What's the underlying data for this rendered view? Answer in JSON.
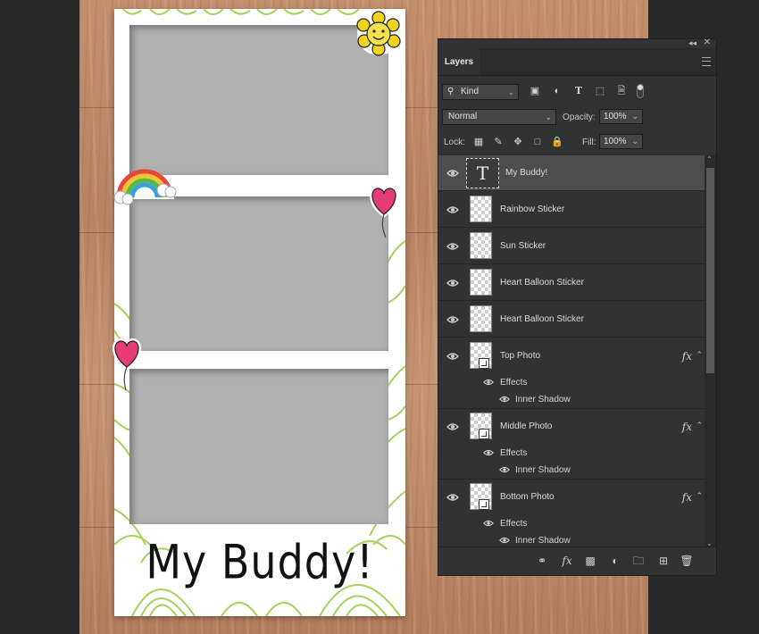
{
  "canvas": {
    "caption": "My Buddy!"
  },
  "panel": {
    "tab_label": "Layers",
    "filter_select": "Kind",
    "blend_mode": "Normal",
    "opacity_label": "Opacity:",
    "opacity_value": "100%",
    "lock_label": "Lock:",
    "fill_label": "Fill:",
    "fill_value": "100%",
    "layers": [
      {
        "name": "My Buddy!",
        "type": "text",
        "selected": true
      },
      {
        "name": "Rainbow Sticker",
        "type": "pixel"
      },
      {
        "name": "Sun Sticker",
        "type": "pixel"
      },
      {
        "name": "Heart Balloon Sticker",
        "type": "pixel"
      },
      {
        "name": "Heart Balloon Sticker",
        "type": "pixel"
      },
      {
        "name": "Top Photo",
        "type": "smart",
        "fx": "fx"
      },
      {
        "name": "Middle Photo",
        "type": "smart",
        "fx": "fx"
      },
      {
        "name": "Bottom Photo",
        "type": "smart",
        "fx": "fx"
      }
    ],
    "effects_label": "Effects",
    "inner_shadow_label": "Inner Shadow"
  },
  "colors": {
    "panel_bg": "#323232",
    "selected_row": "#4d4d4d",
    "doodle_green": "#a6d15a",
    "photo_gray": "#b0b0b0"
  }
}
